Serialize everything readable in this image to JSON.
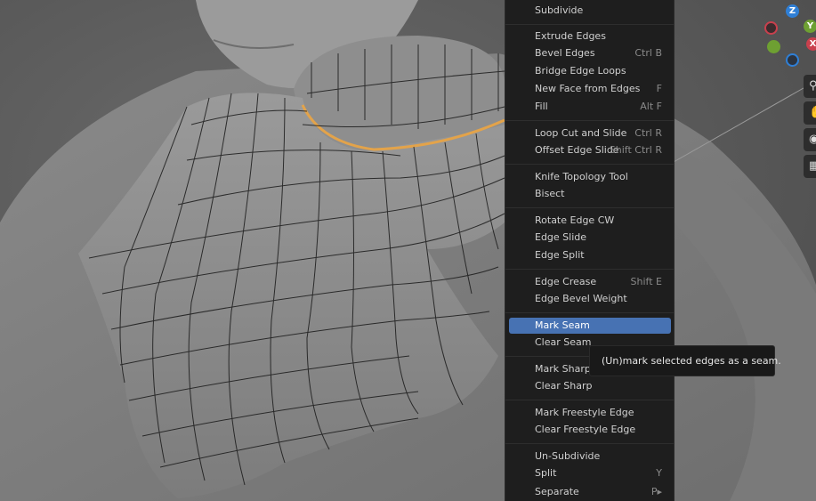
{
  "menu": {
    "items": [
      {
        "label": "Subdivide",
        "shortcut": ""
      },
      {
        "label": "Extrude Edges",
        "shortcut": ""
      },
      {
        "label": "Bevel Edges",
        "shortcut": "Ctrl B"
      },
      {
        "label": "Bridge Edge Loops",
        "shortcut": ""
      },
      {
        "label": "New Face from Edges",
        "shortcut": "F"
      },
      {
        "label": "Fill",
        "shortcut": "Alt F"
      },
      {
        "label": "Loop Cut and Slide",
        "shortcut": "Ctrl R"
      },
      {
        "label": "Offset Edge Slide",
        "shortcut": "Shift Ctrl R"
      },
      {
        "label": "Knife Topology Tool",
        "shortcut": ""
      },
      {
        "label": "Bisect",
        "shortcut": ""
      },
      {
        "label": "Rotate Edge CW",
        "shortcut": ""
      },
      {
        "label": "Edge Slide",
        "shortcut": ""
      },
      {
        "label": "Edge Split",
        "shortcut": ""
      },
      {
        "label": "Edge Crease",
        "shortcut": "Shift E"
      },
      {
        "label": "Edge Bevel Weight",
        "shortcut": ""
      },
      {
        "label": "Mark Seam",
        "shortcut": ""
      },
      {
        "label": "Clear Seam",
        "shortcut": ""
      },
      {
        "label": "Mark Sharp",
        "shortcut": ""
      },
      {
        "label": "Clear Sharp",
        "shortcut": ""
      },
      {
        "label": "Mark Freestyle Edge",
        "shortcut": ""
      },
      {
        "label": "Clear Freestyle Edge",
        "shortcut": ""
      },
      {
        "label": "Un-Subdivide",
        "shortcut": ""
      },
      {
        "label": "Split",
        "shortcut": "Y"
      },
      {
        "label": "Separate",
        "shortcut": "P▸"
      }
    ],
    "highlighted_item": "Mark Seam"
  },
  "tooltip": {
    "text": "(Un)mark selected edges as a seam."
  },
  "gizmo": {
    "z_label": "Z",
    "y_label": "Y",
    "x_label": "X",
    "colors": {
      "x": "#c9404d",
      "y": "#6ea032",
      "z": "#2f7fd6",
      "neg": "#1e1e1e"
    }
  },
  "colors": {
    "menu_bg": "#1e1e1e",
    "highlight": "#4772b3",
    "mesh_wire": "#1a1a1a",
    "selection_edge": "#e3a34a"
  },
  "viewport_icons": [
    "zoom-icon",
    "hand-pan-icon",
    "camera-icon",
    "grid-icon"
  ]
}
